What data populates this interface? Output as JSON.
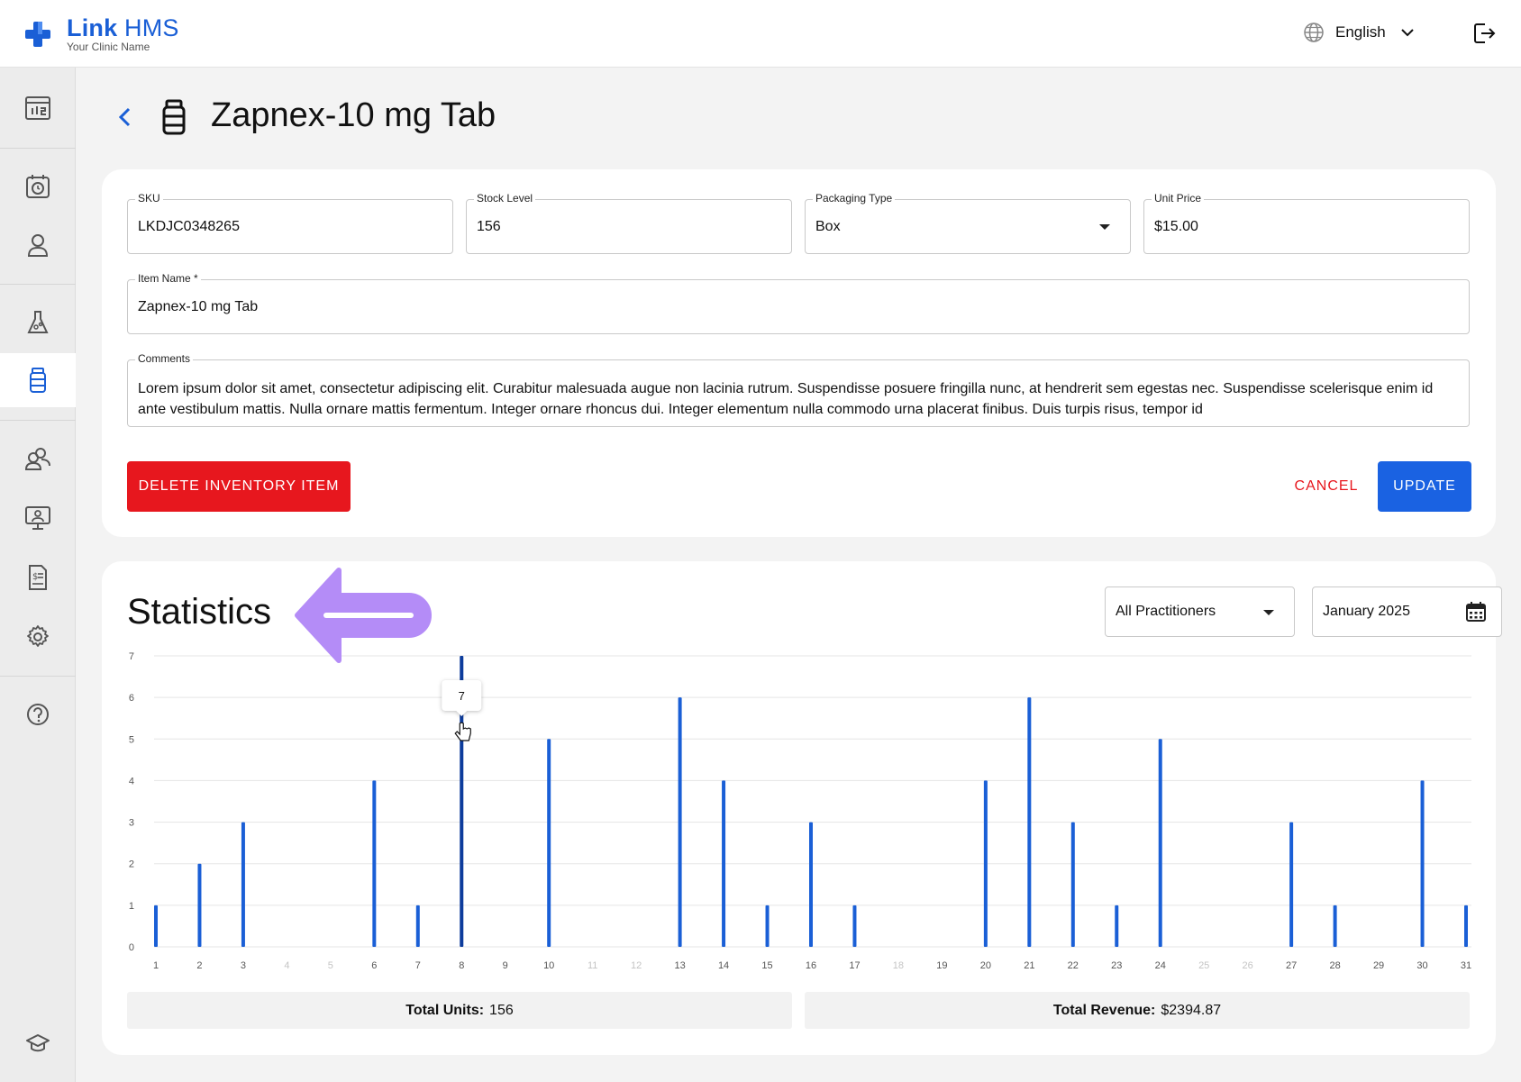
{
  "app": {
    "logo_name_bold": "Link",
    "logo_name_light": "HMS",
    "logo_sub": "Your Clinic Name",
    "brand_color": "#1a5fd6"
  },
  "header": {
    "language": "English",
    "language_icon": "globe-icon",
    "logout_icon": "logout-icon"
  },
  "sidebar": {
    "items": [
      {
        "name": "dashboard",
        "icon": "dashboard-icon"
      },
      {
        "name": "appointments",
        "icon": "calendar-clock-icon"
      },
      {
        "name": "patients",
        "icon": "person-icon"
      },
      {
        "name": "lab",
        "icon": "flask-icon"
      },
      {
        "name": "inventory",
        "icon": "medicine-bottle-icon",
        "active": true
      },
      {
        "name": "staff",
        "icon": "people-icon"
      },
      {
        "name": "telehealth",
        "icon": "monitor-person-icon"
      },
      {
        "name": "billing",
        "icon": "invoice-icon"
      },
      {
        "name": "settings",
        "icon": "gear-icon"
      },
      {
        "name": "help",
        "icon": "help-icon"
      },
      {
        "name": "training",
        "icon": "graduation-cap-icon"
      }
    ]
  },
  "page": {
    "title": "Zapnex-10 mg Tab"
  },
  "form": {
    "sku_label": "SKU",
    "sku_value": "LKDJC0348265",
    "stock_label": "Stock Level",
    "stock_value": "156",
    "packaging_label": "Packaging Type",
    "packaging_value": "Box",
    "price_label": "Unit Price",
    "price_value": "$15.00",
    "item_name_label": "Item Name *",
    "item_name_value": "Zapnex-10 mg Tab",
    "comments_label": "Comments",
    "comments_value": "Lorem ipsum dolor sit amet, consectetur adipiscing elit. Curabitur malesuada augue non lacinia rutrum. Suspendisse posuere fringilla nunc, at hendrerit sem egestas nec. Suspendisse scelerisque enim id ante vestibulum mattis. Nulla ornare mattis fermentum. Integer ornare rhoncus dui. Integer elementum nulla commodo urna placerat finibus. Duis turpis risus, tempor id",
    "delete_label": "DELETE INVENTORY ITEM",
    "cancel_label": "CANCEL",
    "update_label": "UPDATE"
  },
  "statistics": {
    "title": "Statistics",
    "practitioner_filter": "All Practitioners",
    "month": "January 2025",
    "total_units_label": "Total Units:",
    "total_units_value": "156",
    "total_revenue_label": "Total Revenue:",
    "total_revenue_value": "$2394.87",
    "tooltip_value": "7"
  },
  "chart_data": {
    "type": "bar",
    "categories": [
      "1",
      "2",
      "3",
      "4",
      "5",
      "6",
      "7",
      "8",
      "9",
      "10",
      "11",
      "12",
      "13",
      "14",
      "15",
      "16",
      "17",
      "18",
      "19",
      "20",
      "21",
      "22",
      "23",
      "24",
      "25",
      "26",
      "27",
      "28",
      "29",
      "30",
      "31"
    ],
    "values": [
      1,
      2,
      3,
      0,
      0,
      4,
      1,
      7,
      0,
      5,
      0,
      0,
      6,
      4,
      1,
      3,
      1,
      0,
      0,
      4,
      6,
      3,
      1,
      5,
      0,
      0,
      3,
      1,
      0,
      4,
      1
    ],
    "yticks": [
      "0",
      "1",
      "2",
      "3",
      "4",
      "5",
      "6",
      "7"
    ],
    "ylim": [
      0,
      7
    ],
    "highlighted_category": "8",
    "bar_color": "#1a5fd6",
    "highlight_color": "#0d3c9c",
    "grid": true
  },
  "annotation": {
    "arrow_color": "#b48cf7"
  }
}
